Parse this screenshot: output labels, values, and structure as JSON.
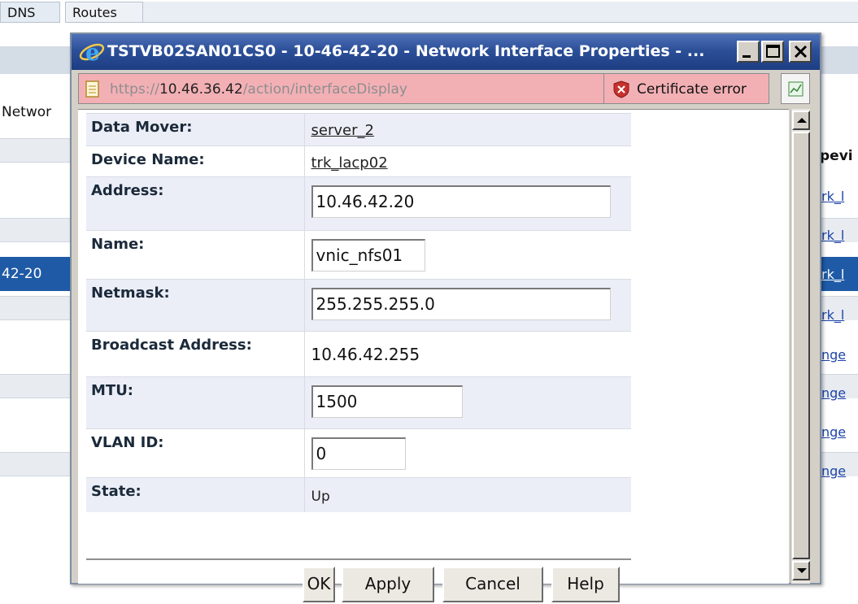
{
  "background": {
    "tabs": [
      "DNS",
      "Routes"
    ],
    "left_label": "Networ",
    "selected_row_text": "42-20",
    "right_header": "pevi",
    "right_links": [
      "rk_l",
      "rk_l",
      "rk_l",
      "rk_l",
      "nge",
      "nge",
      "nge",
      "nge"
    ]
  },
  "dialog": {
    "title": "TSTVB02SAN01CS0 - 10-46-42-20 - Network Interface Properties - ...",
    "address_bar": {
      "url_scheme": "https://",
      "url_host": "10.46.36.42",
      "url_path": "/action/interfaceDisplay",
      "certificate_text": "Certificate error"
    },
    "fields": {
      "data_mover": {
        "label": "Data Mover:",
        "value": "server_2"
      },
      "device_name": {
        "label": "Device Name:",
        "value": "trk_lacp02"
      },
      "address": {
        "label": "Address:",
        "value": "10.46.42.20"
      },
      "name": {
        "label": "Name:",
        "value": "vnic_nfs01"
      },
      "netmask": {
        "label": "Netmask:",
        "value": "255.255.255.0"
      },
      "broadcast": {
        "label": "Broadcast Address:",
        "value": "10.46.42.255"
      },
      "mtu": {
        "label": "MTU:",
        "value": "1500"
      },
      "vlan_id": {
        "label": "VLAN ID:",
        "value": "0"
      },
      "state": {
        "label": "State:",
        "value": "Up"
      }
    },
    "buttons": {
      "ok": "OK",
      "apply": "Apply",
      "cancel": "Cancel",
      "help": "Help"
    }
  },
  "colors": {
    "titlebar": "#2c4f98",
    "address_bar_error": "#f2b0b5",
    "selected_row": "#1f5aa6",
    "link": "#1d44a8"
  },
  "icons": [
    "ie-icon",
    "minimize-icon",
    "maximize-icon",
    "close-icon",
    "page-icon",
    "certificate-error-icon",
    "report-icon",
    "scroll-up-icon",
    "scroll-down-icon"
  ]
}
